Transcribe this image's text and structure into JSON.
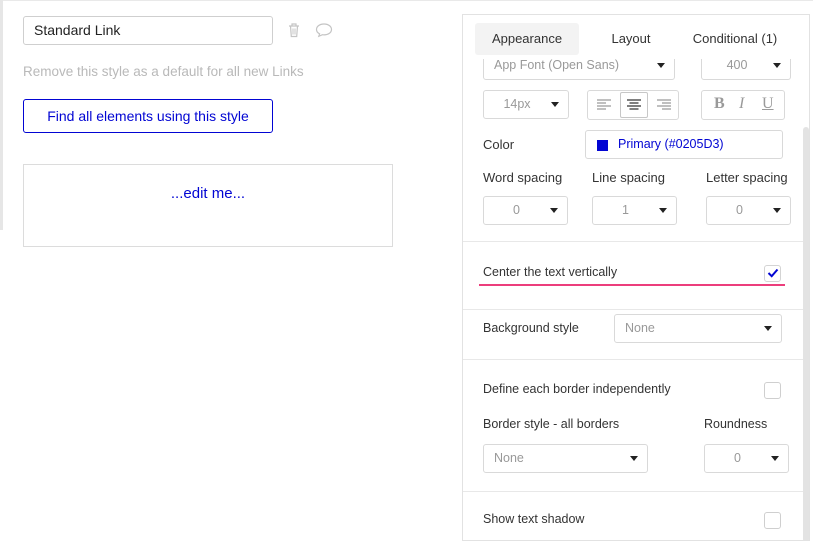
{
  "editor": {
    "style_name": "Standard Link",
    "remove_default_text": "Remove this style as a default for all new Links",
    "find_elements_label": "Find all elements using this style",
    "preview_text": "...edit me..."
  },
  "tabs": [
    {
      "label": "Appearance",
      "active": true
    },
    {
      "label": "Layout",
      "active": false
    },
    {
      "label": "Conditional (1)",
      "active": false
    }
  ],
  "font": {
    "family": "App Font (Open Sans)",
    "weight": "400",
    "size": "14px",
    "alignment_selected": "center",
    "style_glyphs": [
      "B",
      "I",
      "U"
    ]
  },
  "color": {
    "label": "Color",
    "value": "Primary (#0205D3)",
    "swatch": "#0205D3"
  },
  "spacing": {
    "word_label": "Word spacing",
    "word_value": "0",
    "line_label": "Line spacing",
    "line_value": "1",
    "letter_label": "Letter spacing",
    "letter_value": "0"
  },
  "center_vertically": {
    "label": "Center the text vertically",
    "checked": true,
    "highlight_color": "#EC3E7C"
  },
  "background": {
    "label": "Background style",
    "value": "None"
  },
  "border": {
    "independent_label": "Define each border independently",
    "independent_checked": false,
    "style_label": "Border style - all borders",
    "style_value": "None",
    "roundness_label": "Roundness",
    "roundness_value": "0"
  },
  "shadow": {
    "label": "Show text shadow",
    "checked": false
  }
}
